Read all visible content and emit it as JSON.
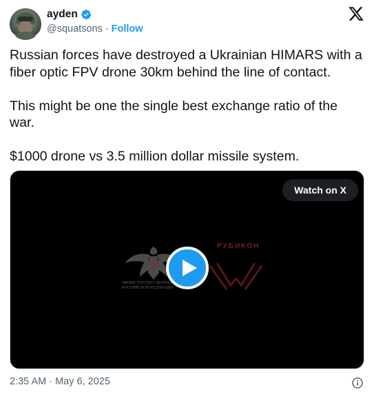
{
  "author": {
    "display_name": "ayden",
    "handle": "@squatsons",
    "separator": "·",
    "follow_label": "Follow",
    "verified": true,
    "verified_color": "#1d9bf0"
  },
  "icons": {
    "platform": "x-logo-icon",
    "verified": "verified-badge-icon",
    "play": "play-icon",
    "info": "info-icon"
  },
  "post": {
    "paragraphs": [
      "Russian forces have destroyed a Ukrainian HIMARS with a fiber optic FPV drone 30km behind the line of contact.",
      "This might be one the single best exchange ratio of the war.",
      "$1000 drone vs 3.5 million dollar missile system."
    ]
  },
  "media": {
    "watch_label": "Watch on X",
    "overlay_caption_left": [
      "МИНИСТЕРСТВО ОБОРОНЫ",
      "РОССИЙСКОЙ ФЕДЕРАЦИИ"
    ],
    "overlay_caption_right": "РУБИКОН"
  },
  "footer": {
    "timestamp": "2:35 AM · May 6, 2025"
  },
  "colors": {
    "accent": "#1d9bf0",
    "text_primary": "#0f1419",
    "text_secondary": "#536471"
  }
}
